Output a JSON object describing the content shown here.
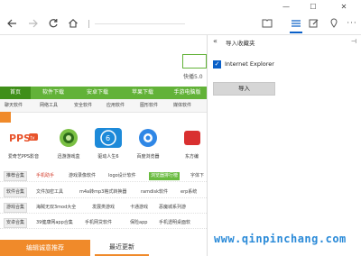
{
  "window": {
    "minimize_icon": "minimize-icon",
    "maximize_icon": "maximize-icon",
    "close_icon": "close-icon"
  },
  "nav": {
    "back_icon": "arrow-left-icon",
    "forward_icon": "arrow-right-icon",
    "refresh_icon": "refresh-icon",
    "home_icon": "home-icon"
  },
  "toolbar": {
    "reading_icon": "book-icon",
    "favorite_icon": "star-icon",
    "hub_icon": "hub-icon",
    "note_icon": "pen-icon",
    "share_icon": "share-icon",
    "more_icon": "ellipsis-icon"
  },
  "page": {
    "kuaibo": "快播5.0",
    "green_tabs": [
      "首页",
      "软件下载",
      "安卓下载",
      "苹果下载",
      "手游电脑版"
    ],
    "sub_tabs": [
      "聊天软件",
      "网络工具",
      "安全软件",
      "应用软件",
      "图形软件",
      "媒体软件"
    ],
    "apps": [
      {
        "label": "爱奇艺PPS影音",
        "color": "#e8532b",
        "logo": "PPS"
      },
      {
        "label": "迅游游戏盒",
        "color": "#6fbf3d",
        "logo": ""
      },
      {
        "label": "驱动人生6",
        "color": "#1d8ad9",
        "logo": "驱动人生6"
      },
      {
        "label": "百度浏览器",
        "color": "#2f87e6",
        "logo": ""
      },
      {
        "label": "东方编",
        "color": "#d93030",
        "logo": ""
      }
    ],
    "tag_rows": [
      {
        "label": "推荐合集",
        "items": [
          "手机助手",
          "游戏录像软件",
          "logo设计软件",
          "浏览器排行榜",
          "字体下"
        ]
      },
      {
        "label": "软件合集",
        "items": [
          "文件加密工具",
          "m4a转mp3格式转换器",
          "ramdisk软件",
          "erp系统"
        ]
      },
      {
        "label": "游戏合集",
        "items": [
          "海贼无双3mod大全",
          "发展类游戏",
          "卡通游戏",
          "恶魔城系列游"
        ]
      },
      {
        "label": "安卓合集",
        "items": [
          "39健康网app合集",
          "手机网贷软件",
          "保险app",
          "手机透明桌面软"
        ]
      }
    ],
    "bottom_left": "编辑诚意推荐",
    "bottom_right": "最近更新"
  },
  "panel": {
    "back_label": "«",
    "title": "导入收藏夹",
    "pin_label": "⊣",
    "checkbox_label": "Internet Explorer",
    "checkbox_checked": true,
    "import_button": "导入"
  },
  "watermark": "www.qinpinchang.com"
}
